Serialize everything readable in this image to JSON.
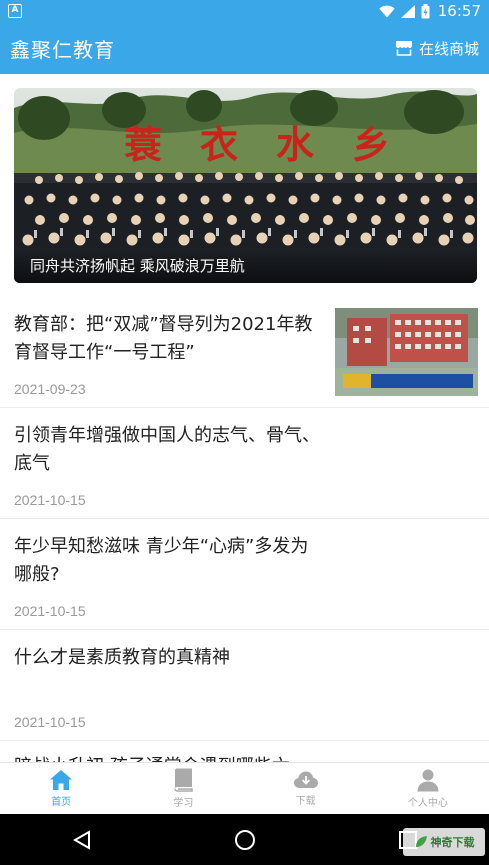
{
  "status_bar": {
    "time": "16:57",
    "icons": [
      "app-icon",
      "wifi-icon",
      "signal-icon",
      "battery-icon"
    ]
  },
  "header": {
    "title": "鑫聚仁教育",
    "action_label": "在线商城",
    "action_icon": "store-icon"
  },
  "banner": {
    "caption": "同舟共济扬帆起 乘风破浪万里航",
    "banner_text": "蓑衣水乡"
  },
  "news": [
    {
      "title": "教育部：把“双减”督导列为2021年教育督导工作“一号工程”",
      "date": "2021-09-23",
      "has_thumbnail": true
    },
    {
      "title": "引领青年增强做中国人的志气、骨气、底气",
      "date": "2021-10-15"
    },
    {
      "title": "年少早知愁滋味 青少年“心病”多发为哪般?",
      "date": "2021-10-15"
    },
    {
      "title": "什么才是素质教育的真精神",
      "date": "2021-10-15"
    },
    {
      "title": "暗战小升初 孩子通常会遇到哪些六",
      "date": ""
    }
  ],
  "bottom_nav": [
    {
      "label": "首页",
      "icon": "home-icon",
      "active": true
    },
    {
      "label": "学习",
      "icon": "book-icon",
      "active": false
    },
    {
      "label": "下载",
      "icon": "cloud-download-icon",
      "active": false
    },
    {
      "label": "个人中心",
      "icon": "person-icon",
      "active": false
    }
  ],
  "watermark": "神奇下载",
  "colors": {
    "primary": "#3aa7e8",
    "inactive": "#aaaaaa",
    "text": "#222222",
    "date": "#999999"
  }
}
